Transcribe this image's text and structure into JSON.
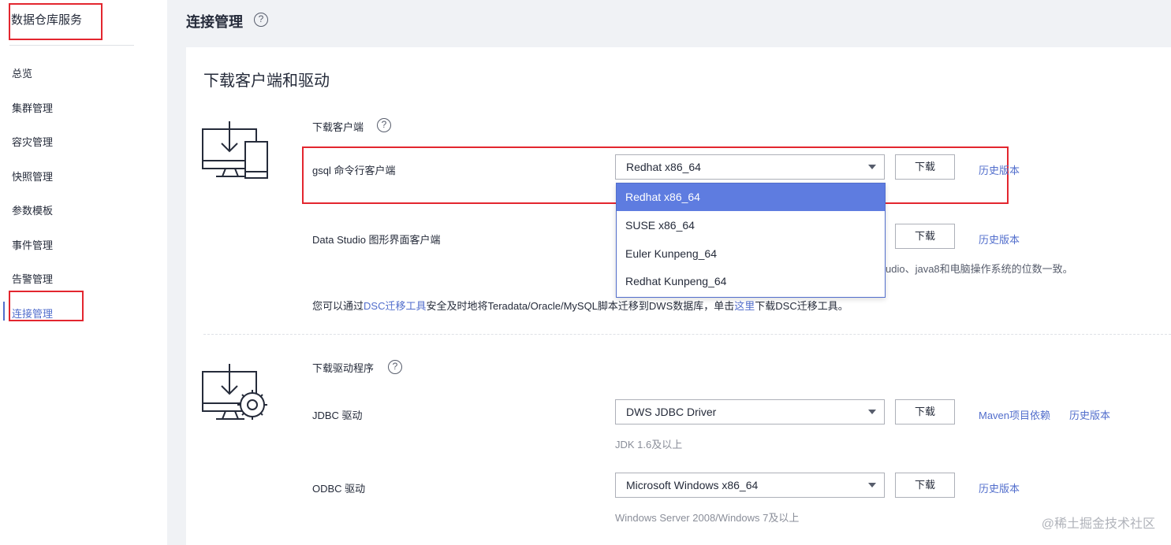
{
  "sidebar": {
    "service_title": "数据仓库服务",
    "items": [
      {
        "label": "总览"
      },
      {
        "label": "集群管理"
      },
      {
        "label": "容灾管理"
      },
      {
        "label": "快照管理"
      },
      {
        "label": "参数模板"
      },
      {
        "label": "事件管理"
      },
      {
        "label": "告警管理"
      },
      {
        "label": "连接管理",
        "active": true
      }
    ]
  },
  "header": {
    "title": "连接管理",
    "help_icon": "?"
  },
  "main": {
    "card_title": "下载客户端和驱动",
    "client_section": {
      "title": "下载客户端",
      "help_icon": "?",
      "icon": "monitor-download-icon",
      "rows": [
        {
          "label": "gsql 命令行客户端",
          "select_value": "Redhat x86_64",
          "button": "下载",
          "link": "历史版本"
        },
        {
          "label": "Data Studio 图形界面客户端",
          "button": "下载",
          "link": "历史版本",
          "hint_partial": "udio、java8和电脑操作系统的位数一致。"
        }
      ],
      "info_line": {
        "prefix": "您可以通过",
        "link1": "DSC迁移工具",
        "middle": "安全及时地将Teradata/Oracle/MySQL脚本迁移到DWS数据库，单击",
        "link2": "这里",
        "suffix": "下载DSC迁移工具。"
      }
    },
    "dropdown": {
      "options": [
        "Redhat x86_64",
        "SUSE x86_64",
        "Euler Kunpeng_64",
        "Redhat Kunpeng_64"
      ],
      "selected_index": 0
    },
    "driver_section": {
      "title": "下载驱动程序",
      "help_icon": "?",
      "icon": "monitor-gear-download-icon",
      "rows": [
        {
          "label": "JDBC 驱动",
          "select_value": "DWS JDBC Driver",
          "button": "下载",
          "link_maven": "Maven项目依赖",
          "link": "历史版本",
          "hint": "JDK 1.6及以上"
        },
        {
          "label": "ODBC 驱动",
          "select_value": "Microsoft Windows x86_64",
          "button": "下载",
          "link": "历史版本",
          "hint": "Windows Server 2008/Windows 7及以上"
        }
      ]
    }
  },
  "watermark": "@稀土掘金技术社区",
  "colors": {
    "accent": "#526ecc",
    "selected_option": "#5e7ce0",
    "highlight_box": "#e3262f"
  }
}
